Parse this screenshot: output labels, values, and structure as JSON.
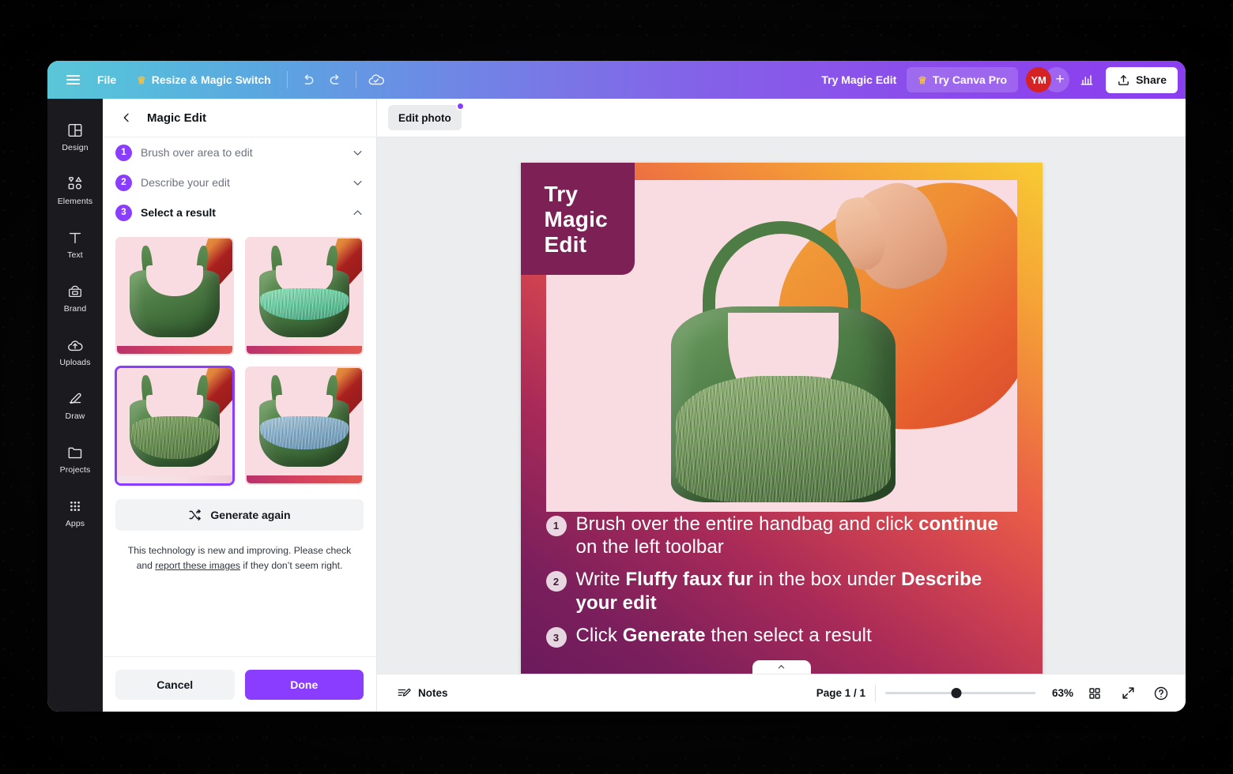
{
  "topbar": {
    "menu_icon": "hamburger-icon",
    "file_label": "File",
    "resize_label": "Resize & Magic Switch",
    "resize_icon": "crown-icon",
    "undo_icon": "undo-icon",
    "redo_icon": "redo-icon",
    "cloud_icon": "cloud-saved-icon",
    "try_magic_edit_label": "Try Magic Edit",
    "try_canva_pro_label": "Try Canva Pro",
    "try_canva_pro_icon": "crown-icon",
    "avatar_initials": "YM",
    "add_people_label": "+",
    "insights_icon": "bar-chart-icon",
    "share_label": "Share",
    "share_icon": "share-upload-icon",
    "gradient_start": "#5bc6d8",
    "gradient_end": "#8a3fee"
  },
  "rail": {
    "items": [
      {
        "label": "Design",
        "icon": "design-layout-icon"
      },
      {
        "label": "Elements",
        "icon": "elements-shapes-icon"
      },
      {
        "label": "Text",
        "icon": "text-t-icon"
      },
      {
        "label": "Brand",
        "icon": "brand-kit-icon"
      },
      {
        "label": "Uploads",
        "icon": "upload-cloud-icon"
      },
      {
        "label": "Draw",
        "icon": "draw-pen-icon"
      },
      {
        "label": "Projects",
        "icon": "folder-icon"
      },
      {
        "label": "Apps",
        "icon": "apps-grid-icon"
      }
    ]
  },
  "panel": {
    "back_icon": "chevron-left-icon",
    "title": "Magic Edit",
    "steps": [
      {
        "num": "1",
        "label": "Brush over area to edit",
        "state": "collapsed",
        "chevron": "chevron-down-icon"
      },
      {
        "num": "2",
        "label": "Describe your edit",
        "state": "collapsed",
        "chevron": "chevron-down-icon"
      },
      {
        "num": "3",
        "label": "Select a result",
        "state": "expanded",
        "chevron": "chevron-up-icon"
      }
    ],
    "results": [
      {
        "name": "result-1",
        "variant": "plain-green-leather",
        "selected": false
      },
      {
        "name": "result-2",
        "variant": "mint-green-fur",
        "selected": false
      },
      {
        "name": "result-3",
        "variant": "olive-green-fur",
        "selected": true
      },
      {
        "name": "result-4",
        "variant": "blue-fur",
        "selected": false
      }
    ],
    "generate_again_label": "Generate again",
    "generate_again_icon": "shuffle-icon",
    "disclaimer_prefix": "This technology is new and improving. Please check and ",
    "disclaimer_link": "report these images",
    "disclaimer_suffix": " if they don’t seem right.",
    "cancel_label": "Cancel",
    "done_label": "Done",
    "accent_color": "#8b3dff"
  },
  "editor": {
    "tab_label": "Edit photo",
    "tab_badge_icon": "notification-dot",
    "collapse_icon": "chevron-up-icon"
  },
  "design": {
    "title_lines": "Try\nMagic\nEdit",
    "title_bg": "#7d2056",
    "instructions": [
      {
        "num": "1",
        "parts": [
          {
            "t": "Brush over the entire handbag and click ",
            "b": false
          },
          {
            "t": "continue",
            "b": true
          },
          {
            "t": " on the left toolbar",
            "b": false
          }
        ]
      },
      {
        "num": "2",
        "parts": [
          {
            "t": "Write ",
            "b": false
          },
          {
            "t": "Fluffy faux fur",
            "b": true
          },
          {
            "t": " in the box under ",
            "b": false
          },
          {
            "t": "Describe your edit",
            "b": true
          }
        ]
      },
      {
        "num": "3",
        "parts": [
          {
            "t": "Click ",
            "b": false
          },
          {
            "t": "Generate",
            "b": true
          },
          {
            "t": " then select a result",
            "b": false
          }
        ]
      }
    ]
  },
  "statusbar": {
    "notes_label": "Notes",
    "notes_icon": "notes-pencil-icon",
    "page_indicator": "Page 1 / 1",
    "zoom_value": "63%",
    "zoom_percent": 63,
    "grid_icon": "grid-view-icon",
    "fullscreen_icon": "expand-icon",
    "help_icon": "help-circle-icon"
  }
}
